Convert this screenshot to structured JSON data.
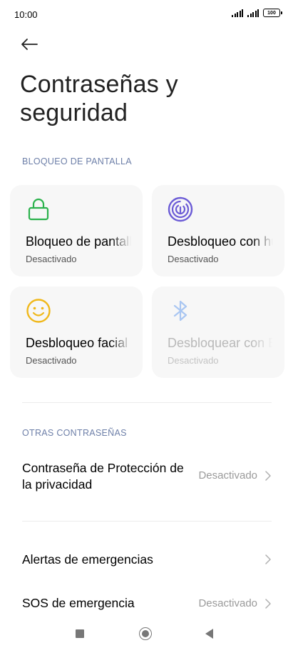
{
  "status_bar": {
    "time": "10:00",
    "battery": "100"
  },
  "header": {
    "title": "Contraseñas y seguridad"
  },
  "screen_lock": {
    "section_label": "BLOQUEO DE PANTALLA",
    "cards": [
      {
        "title": "Bloqueo de pantalla",
        "subtitle": "Desactivado",
        "icon": "lock-icon"
      },
      {
        "title": "Desbloqueo con huella",
        "subtitle": "Desactivado",
        "icon": "fingerprint-icon"
      },
      {
        "title": "Desbloqueo facial",
        "subtitle": "Desactivado",
        "icon": "face-icon"
      },
      {
        "title": "Desbloquear con Bluetooth",
        "subtitle": "Desactivado",
        "icon": "bluetooth-icon",
        "disabled": true
      }
    ]
  },
  "other_passwords": {
    "section_label": "OTRAS CONTRASEÑAS",
    "privacy_password": {
      "label": "Contraseña de Protección de la privacidad",
      "value": "Desactivado"
    }
  },
  "emergency": {
    "alerts": {
      "label": "Alertas de emergencias"
    },
    "sos": {
      "label": "SOS de emergencia",
      "value": "Desactivado"
    }
  },
  "colors": {
    "lock_icon": "#2bb24c",
    "fingerprint_icon": "#6b5bd6",
    "face_icon": "#f0b81a",
    "bluetooth_icon": "#a9c6f2",
    "section_label": "#6d7fa8"
  }
}
